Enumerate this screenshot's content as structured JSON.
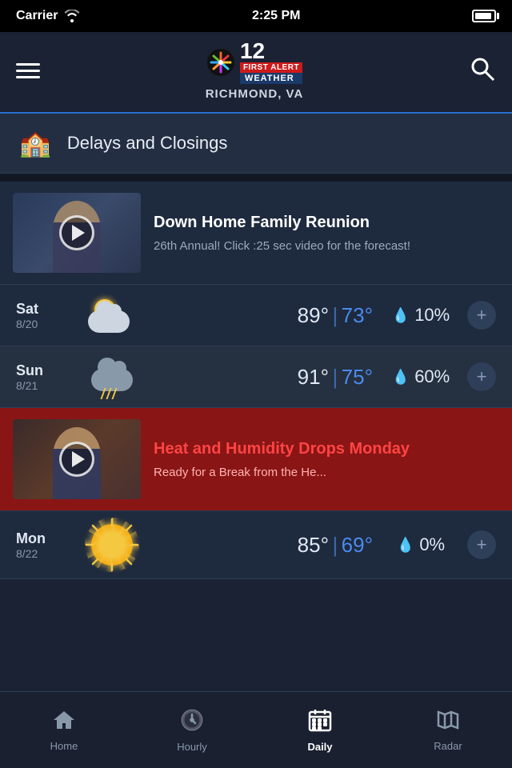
{
  "statusBar": {
    "carrier": "Carrier",
    "time": "2:25 PM",
    "battery": "100"
  },
  "header": {
    "menuLabel": "menu",
    "logoNumber": "12",
    "firstAlert": "FIRST ALERT",
    "weather": "WEATHER",
    "location": "RICHMOND, VA",
    "searchLabel": "search"
  },
  "delaysBanner": {
    "icon": "🏫",
    "text": "Delays and Closings"
  },
  "newsItems": [
    {
      "id": "news-1",
      "title": "Down Home Family Reunion",
      "description": "26th Annual! Click :25 sec video for the forecast!",
      "hasVideo": true,
      "style": "normal"
    },
    {
      "id": "news-2",
      "title": "Heat and Humidity Drops Monday",
      "description": "Ready for a Break from the He...",
      "hasVideo": true,
      "style": "red"
    }
  ],
  "weatherRows": [
    {
      "dayName": "Sat",
      "dayDate": "8/20",
      "iconType": "partly-cloudy",
      "tempHigh": "89°",
      "tempSep": "|",
      "tempLow": "73°",
      "precip": "10%",
      "alt": false
    },
    {
      "dayName": "Sun",
      "dayDate": "8/21",
      "iconType": "cloudy-lightning",
      "tempHigh": "91°",
      "tempSep": "|",
      "tempLow": "75°",
      "precip": "60%",
      "alt": true
    },
    {
      "dayName": "Mon",
      "dayDate": "8/22",
      "iconType": "sunny",
      "tempHigh": "85°",
      "tempSep": "|",
      "tempLow": "69°",
      "precip": "0%",
      "alt": false
    }
  ],
  "bottomNav": [
    {
      "id": "home",
      "label": "Home",
      "icon": "home",
      "active": false
    },
    {
      "id": "hourly",
      "label": "Hourly",
      "icon": "clock",
      "active": false
    },
    {
      "id": "daily",
      "label": "Daily",
      "icon": "calendar",
      "active": true
    },
    {
      "id": "radar",
      "label": "Radar",
      "icon": "radar",
      "active": false
    }
  ]
}
